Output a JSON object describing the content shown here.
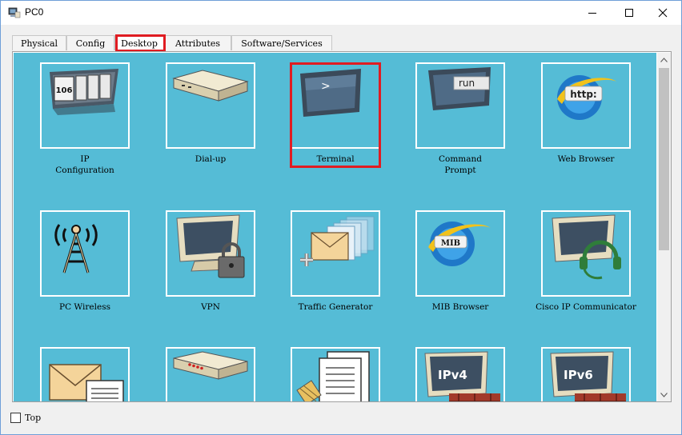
{
  "window": {
    "title": "PC0",
    "app_icon": "pc-monitor-icon",
    "controls": [
      "minimize-icon",
      "maximize-icon",
      "close-icon"
    ]
  },
  "tabs": [
    {
      "label": "Physical",
      "active": false
    },
    {
      "label": "Config",
      "active": false
    },
    {
      "label": "Desktop",
      "active": true
    },
    {
      "label": "Attributes",
      "active": false
    },
    {
      "label": "Software/Services",
      "active": false
    }
  ],
  "desktop": {
    "background_color": "#55bcd6",
    "highlight_color": "#e01c22",
    "apps": [
      {
        "label": "IP\nConfiguration",
        "icon": "ip-configuration-icon"
      },
      {
        "label": "Dial-up",
        "icon": "dial-up-modem-icon"
      },
      {
        "label": "Terminal",
        "icon": "terminal-icon",
        "icon_text": ">",
        "highlighted": true
      },
      {
        "label": "Command\nPrompt",
        "icon": "command-prompt-icon",
        "icon_text": "run"
      },
      {
        "label": "Web Browser",
        "icon": "web-browser-icon",
        "icon_text": "http:"
      },
      {
        "label": "PC Wireless",
        "icon": "pc-wireless-icon"
      },
      {
        "label": "VPN",
        "icon": "vpn-icon"
      },
      {
        "label": "Traffic Generator",
        "icon": "traffic-generator-icon"
      },
      {
        "label": "MIB Browser",
        "icon": "mib-browser-icon",
        "icon_text": "MIB"
      },
      {
        "label": "Cisco IP Communicator",
        "icon": "cisco-ip-communicator-icon"
      },
      {
        "label": "",
        "icon": "email-icon"
      },
      {
        "label": "",
        "icon": "pppoe-dialer-icon"
      },
      {
        "label": "",
        "icon": "text-editor-icon"
      },
      {
        "label": "",
        "icon": "firewall-ipv4-icon",
        "icon_text": "IPv4"
      },
      {
        "label": "",
        "icon": "firewall-ipv6-icon",
        "icon_text": "IPv6"
      }
    ],
    "ip_config_icon_text": "106"
  },
  "footer": {
    "top_checkbox_label": "Top",
    "top_checked": false
  }
}
